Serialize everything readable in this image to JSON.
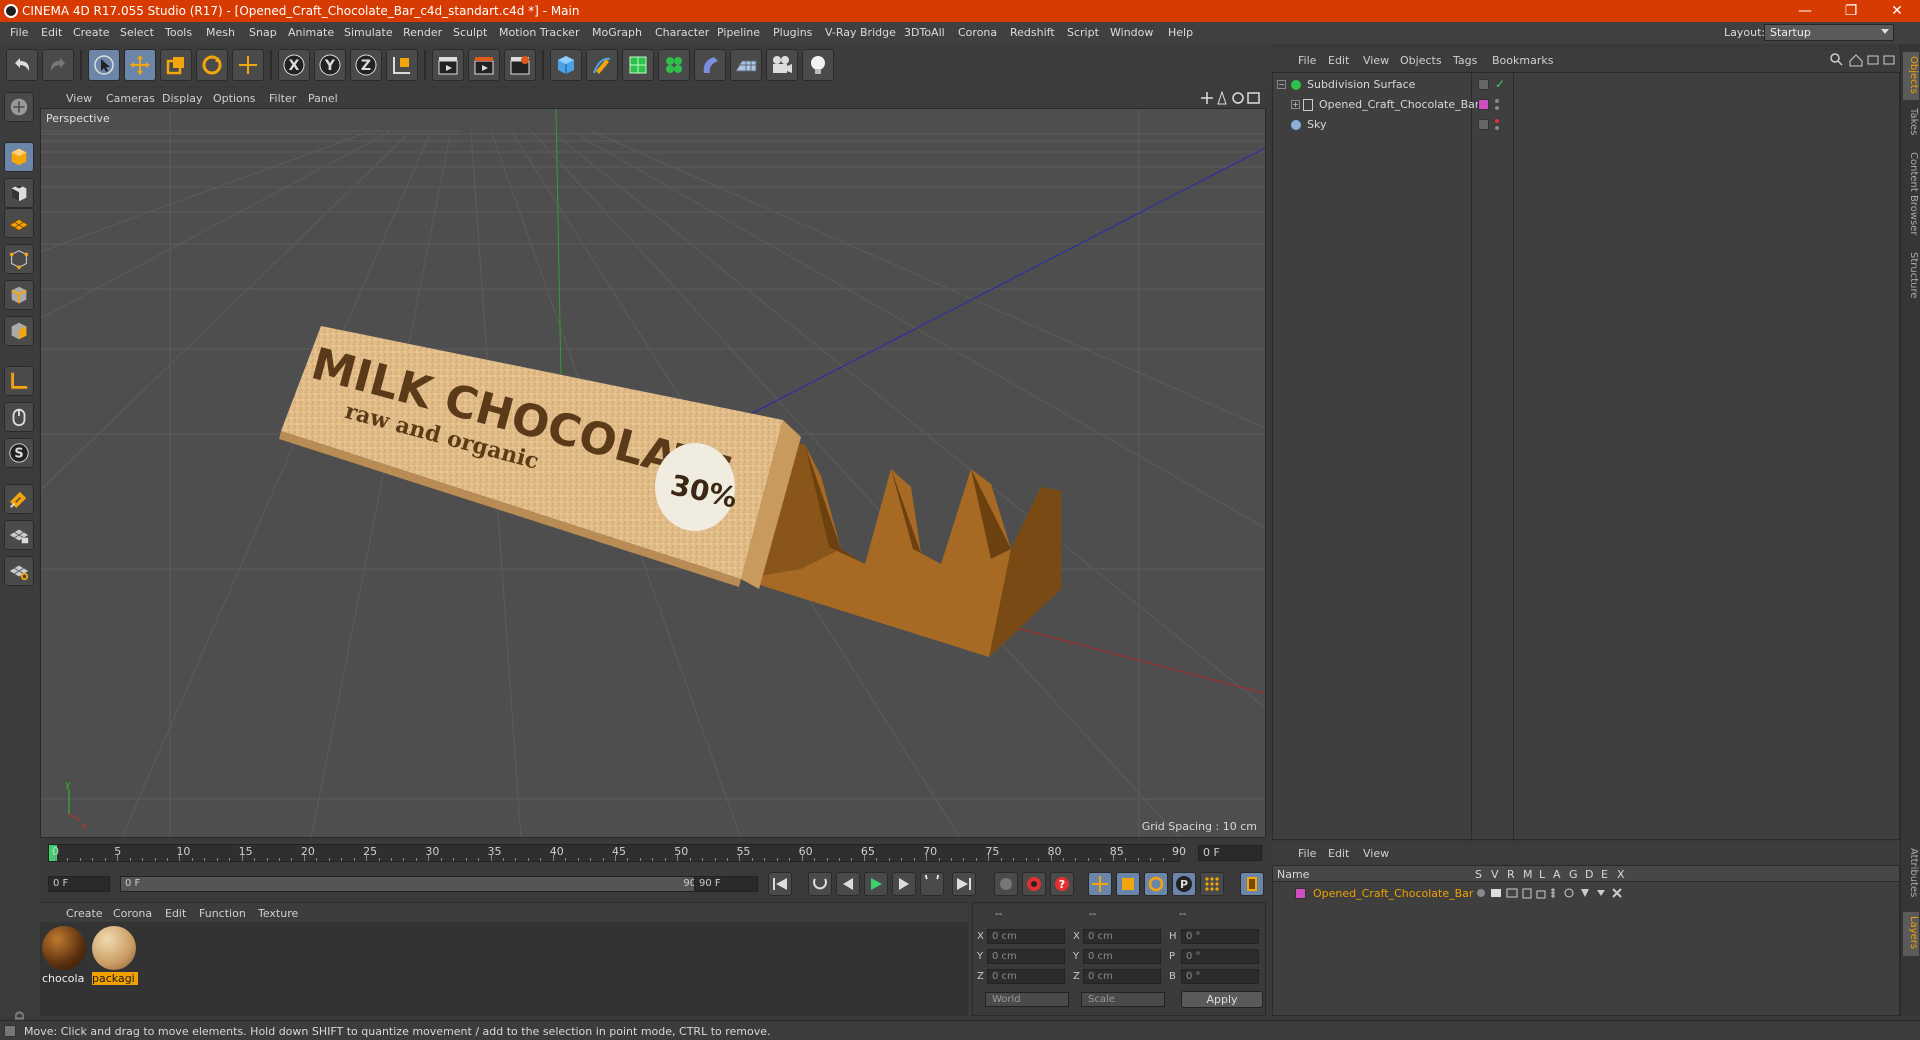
{
  "window": {
    "title": "CINEMA 4D R17.055 Studio (R17) - [Opened_Craft_Chocolate_Bar_c4d_standart.c4d *] - Main",
    "minimize": "—",
    "restore": "❐",
    "close": "✕"
  },
  "menubar": {
    "items": [
      "File",
      "Edit",
      "Create",
      "Select",
      "Tools",
      "Mesh",
      "Snap",
      "Animate",
      "Simulate",
      "Render",
      "Sculpt",
      "Motion Tracker",
      "MoGraph",
      "Character",
      "Pipeline",
      "Plugins",
      "V-Ray Bridge",
      "3DToAll",
      "Corona",
      "Redshift",
      "Script",
      "Window",
      "Help"
    ],
    "layout_label": "Layout:",
    "layout_value": "Startup"
  },
  "viewport": {
    "menu": [
      "View",
      "Cameras",
      "Display",
      "Options",
      "Filter",
      "Panel"
    ],
    "label": "Perspective",
    "grid_spacing": "Grid Spacing : 10 cm",
    "wrapper_title": "MILK CHOCOLATE",
    "wrapper_subtitle": "raw and organic",
    "badge": "30%"
  },
  "timeline": {
    "ticks": [
      "0",
      "5",
      "10",
      "15",
      "20",
      "25",
      "30",
      "35",
      "40",
      "45",
      "50",
      "55",
      "60",
      "65",
      "70",
      "75",
      "80",
      "85",
      "90"
    ],
    "end_field": "0 F",
    "start_field": "0 F",
    "range_min": "0 F",
    "range_max": "90 F",
    "max_field": "90 F"
  },
  "material_manager": {
    "menu": [
      "Create",
      "Corona",
      "Edit",
      "Function",
      "Texture"
    ],
    "materials": [
      {
        "name": "chocola",
        "selected": false
      },
      {
        "name": "packagi",
        "selected": true
      }
    ]
  },
  "coordinates": {
    "header": [
      "--",
      "--",
      "--"
    ],
    "rows": [
      {
        "axis": "X",
        "pos": "0 cm",
        "axis2": "X",
        "size": "0 cm",
        "rot_label": "H",
        "rot": "0 °"
      },
      {
        "axis": "Y",
        "pos": "0 cm",
        "axis2": "Y",
        "size": "0 cm",
        "rot_label": "P",
        "rot": "0 °"
      },
      {
        "axis": "Z",
        "pos": "0 cm",
        "axis2": "Z",
        "size": "0 cm",
        "rot_label": "B",
        "rot": "0 °"
      }
    ],
    "mode_world": "World",
    "mode_scale": "Scale",
    "apply": "Apply"
  },
  "object_manager": {
    "menu": [
      "File",
      "Edit",
      "View",
      "Objects",
      "Tags",
      "Bookmarks"
    ],
    "objects": [
      {
        "name": "Subdivision Surface",
        "color": "#2fbf4a"
      },
      {
        "name": "Opened_Craft_Chocolate_Bar",
        "color": "#d04fc0"
      },
      {
        "name": "Sky",
        "color": "#8ab0d8"
      }
    ]
  },
  "layer_manager": {
    "menu": [
      "File",
      "Edit",
      "View"
    ],
    "columns": [
      "Name",
      "S",
      "V",
      "R",
      "M",
      "L",
      "A",
      "G",
      "D",
      "E",
      "X"
    ],
    "layers": [
      {
        "name": "Opened_Craft_Chocolate_Bar",
        "color": "#d04fc0"
      }
    ]
  },
  "side_tabs": [
    "Objects",
    "Takes",
    "Content Browser",
    "Structure",
    "Attributes",
    "Layers"
  ],
  "status": "Move: Click and drag to move elements. Hold down SHIFT to quantize movement / add to the selection in point mode, CTRL to remove.",
  "colors": {
    "accent": "#d83b01",
    "selection": "#6b86a8",
    "play_green": "#3cd16a",
    "highlight_orange": "#f0a000"
  }
}
